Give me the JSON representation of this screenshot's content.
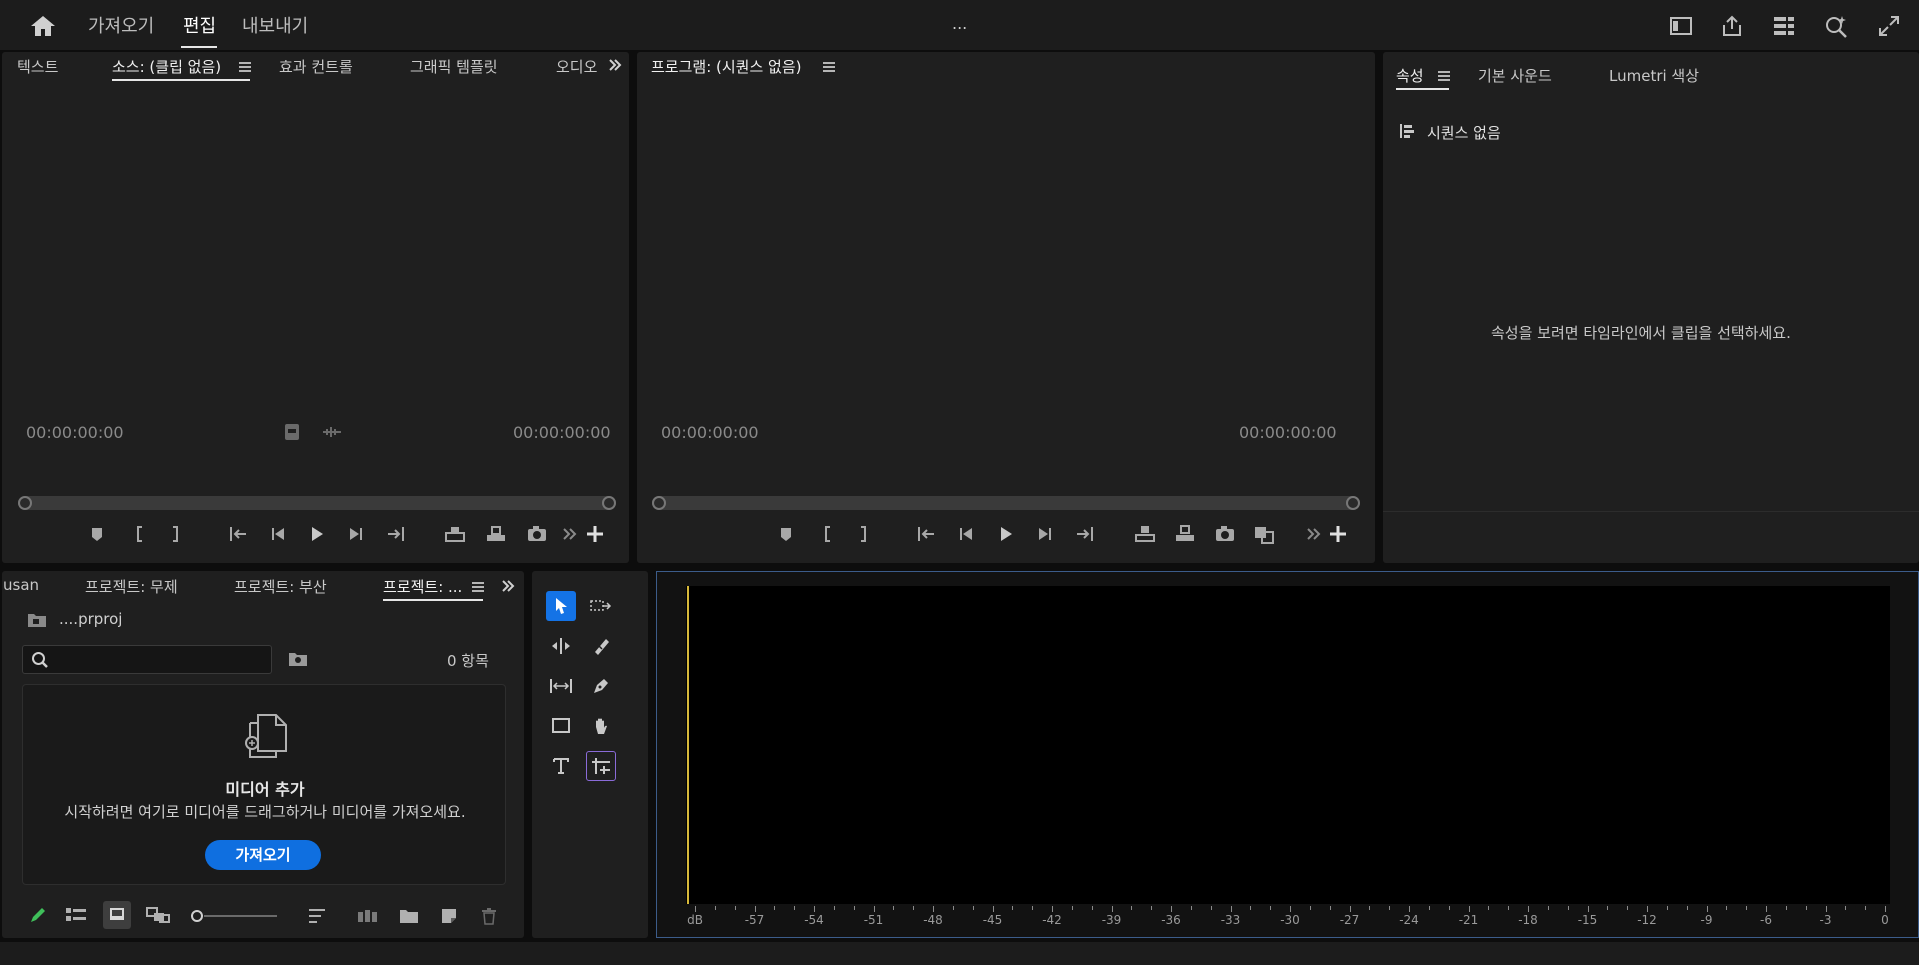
{
  "topbar": {
    "home_icon": "home-icon",
    "nav": [
      "가져오기",
      "편집",
      "내보내기"
    ],
    "active_nav": "편집",
    "center_text": "...",
    "icons": [
      "workspace-icon",
      "share-icon",
      "stacked-panels-icon",
      "quick-search-icon",
      "fullscreen-icon"
    ]
  },
  "source_panel": {
    "tabs": [
      "텍스트",
      "소스: (클립 없음)",
      "효과 컨트롤",
      "그래픽 템플릿",
      "오디오"
    ],
    "active_tab": "소스: (클립 없음)",
    "timecode_left": "00:00:00:00",
    "timecode_right": "00:00:00:00"
  },
  "program_panel": {
    "title": "프로그램: (시퀀스 없음)",
    "timecode_left": "00:00:00:00",
    "timecode_right": "00:00:00:00"
  },
  "properties_panel": {
    "tabs": [
      "속성",
      "기본 사운드",
      "Lumetri 색상"
    ],
    "active_tab": "속성",
    "sequence_label": "시퀀스 없음",
    "message": "속성을 보려면 타임라인에서 클립을 선택하세요."
  },
  "project_panel": {
    "tabs": [
      "usan",
      "프로젝트: 무제",
      "프로젝트: 부산",
      "프로젝트: ..."
    ],
    "active_tab": "프로젝트: ...",
    "file_name": "....prproj",
    "search_placeholder": "",
    "item_count": "0 항목",
    "drop_title": "미디어 추가",
    "drop_text": "시작하려면 여기로 미디어를 드래그하거나 미디어를 가져오세요.",
    "import_label": "가져오기",
    "zoom_slider_value": 0
  },
  "tools": [
    "selection-tool",
    "track-select-tool",
    "ripple-edit-tool",
    "razor-tool",
    "slip-tool",
    "pen-tool",
    "rectangle-tool",
    "hand-tool",
    "type-tool",
    "remix-tool"
  ],
  "audio_meter": {
    "labels": [
      "dB",
      "-57",
      "-54",
      "-51",
      "-48",
      "-45",
      "-42",
      "-39",
      "-36",
      "-33",
      "-30",
      "-27",
      "-24",
      "-21",
      "-18",
      "-15",
      "-12",
      "-9",
      "-6",
      "-3",
      "0"
    ]
  },
  "colors": {
    "accent": "#1473e6",
    "playhead": "#d6b83a",
    "panel": "#1f1f1f"
  }
}
